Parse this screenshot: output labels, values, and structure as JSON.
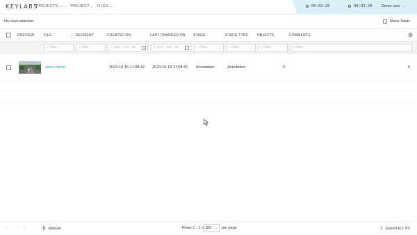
{
  "header": {
    "logo": "KEYLABS",
    "nav": [
      {
        "label": "PROJECTS",
        "dropdown": true
      },
      {
        "label": "PROJECT",
        "dropdown": false
      },
      {
        "label": "FILES",
        "dropdown": true
      }
    ],
    "timer1": "00:02:20",
    "timer2": "00:02:20",
    "user": "Demo user",
    "accent": "#d9f0f6"
  },
  "toolbar": {
    "selection_text": "No rows selected",
    "show_totals_label": "Show Totals"
  },
  "table": {
    "columns": [
      "PREVIEW",
      "FILE",
      "SEGMENT",
      "CREATED ON",
      "LAST CHANGED ON",
      "STAGE",
      "STAGE TYPE",
      "OBJECTS",
      "COMMENTS"
    ],
    "sort_indicator": "↓",
    "filters": {
      "file": "Filter...",
      "segment": "Filter...",
      "created_on": "yyyy - mm - dd",
      "last_changed_on": "yyyy - mm - dd",
      "stage": "Filter...",
      "stage_type": "Filter...",
      "objects": "Filter...",
      "comments": "Filter..."
    },
    "rows": [
      {
        "file": "video.webm",
        "created_on": "2024-10-15 17:08:42",
        "last_changed_on": "2024-10-15 17:08:42",
        "stage": "Annotation",
        "stage_type": "Annotation",
        "objects": "0",
        "comments": "0"
      }
    ]
  },
  "footer": {
    "reload_label": "Reload",
    "rows_info": "Rows 1 - 1 of 1",
    "page_size": "50",
    "per_page_label": "per page",
    "export_label": "Export to CSV"
  }
}
